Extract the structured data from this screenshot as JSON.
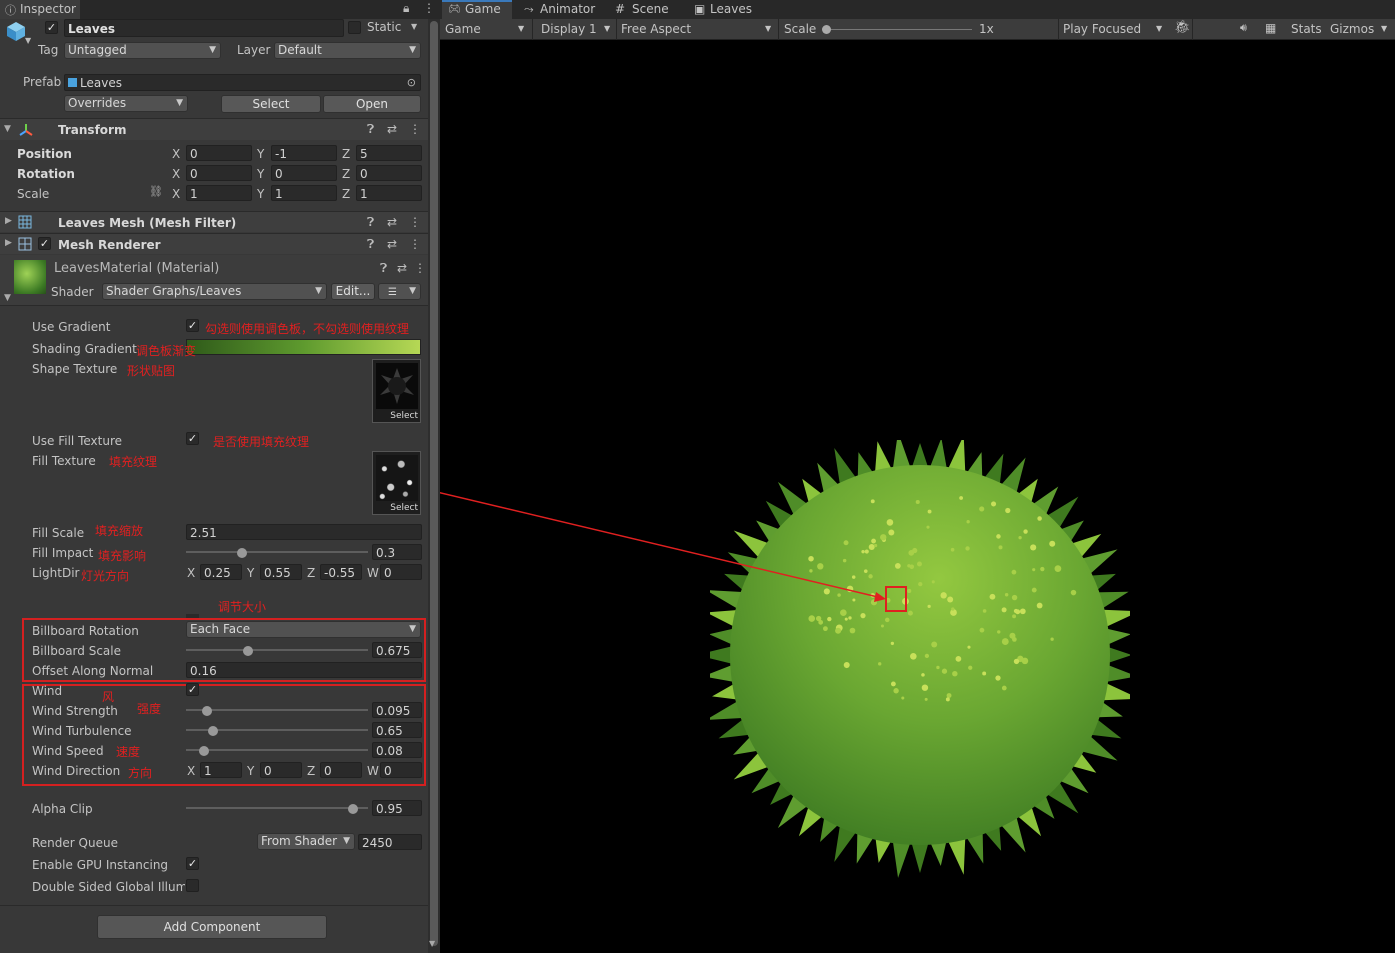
{
  "inspector": {
    "tab_label": "Inspector",
    "object_name": "Leaves",
    "static_label": "Static",
    "tag_label": "Tag",
    "tag_value": "Untagged",
    "layer_label": "Layer",
    "layer_value": "Default",
    "prefab_label": "Prefab",
    "prefab_value": "Leaves",
    "overrides_label": "Overrides",
    "select_button": "Select",
    "open_button": "Open",
    "transform": {
      "title": "Transform",
      "position_label": "Position",
      "rotation_label": "Rotation",
      "scale_label": "Scale",
      "position": {
        "x": "0",
        "y": "-1",
        "z": "5"
      },
      "rotation": {
        "x": "0",
        "y": "0",
        "z": "0"
      },
      "scale": {
        "x": "1",
        "y": "1",
        "z": "1"
      }
    },
    "mesh_filter_title": "Leaves Mesh (Mesh Filter)",
    "mesh_renderer_title": "Mesh Renderer",
    "material": {
      "title": "LeavesMaterial (Material)",
      "shader_label": "Shader",
      "shader_value": "Shader Graphs/Leaves",
      "edit_button": "Edit...",
      "use_gradient_label": "Use Gradient",
      "shading_gradient_label": "Shading Gradient",
      "shape_texture_label": "Shape Texture",
      "texture_select": "Select",
      "use_fill_texture_label": "Use Fill Texture",
      "fill_texture_label": "Fill Texture",
      "fill_scale_label": "Fill Scale",
      "fill_scale_value": "2.51",
      "fill_impact_label": "Fill Impact",
      "fill_impact_value": "0.3",
      "fill_impact_level": 0.3,
      "lightdir_label": "LightDir",
      "lightdir": {
        "x": "0.25",
        "y": "0.55",
        "z": "-0.55",
        "w": "0"
      },
      "billboard_rotation_label": "Billboard Rotation",
      "billboard_rotation_value": "Each Face",
      "billboard_scale_label": "Billboard Scale",
      "billboard_scale_value": "0.675",
      "billboard_scale_level": 0.34,
      "offset_normal_label": "Offset Along Normal",
      "offset_normal_value": "0.16",
      "wind_label": "Wind",
      "wind_strength_label": "Wind Strength",
      "wind_strength_value": "0.095",
      "wind_strength_level": 0.12,
      "wind_turbulence_label": "Wind Turbulence",
      "wind_turbulence_value": "0.65",
      "wind_turbulence_level": 0.15,
      "wind_speed_label": "Wind Speed",
      "wind_speed_value": "0.08",
      "wind_speed_level": 0.1,
      "wind_direction_label": "Wind Direction",
      "wind_direction": {
        "x": "1",
        "y": "0",
        "z": "0",
        "w": "0"
      },
      "alpha_clip_label": "Alpha Clip",
      "alpha_clip_value": "0.95",
      "alpha_clip_level": 0.92,
      "render_queue_label": "Render Queue",
      "render_queue_mode": "From Shader",
      "render_queue_value": "2450",
      "gpu_instancing_label": "Enable GPU Instancing",
      "double_sided_label": "Double Sided Global Illumin"
    },
    "add_component_button": "Add Component"
  },
  "annotations": {
    "use_gradient": "勾选则使用调色板，不勾选则使用纹理",
    "shading_gradient": "调色板渐变",
    "shape_texture": "形状贴图",
    "use_fill_texture": "是否使用填充纹理",
    "fill_texture": "填充纹理",
    "fill_scale": "填充缩放",
    "fill_impact": "填充影响",
    "lightdir": "灯光方向",
    "resize": "调节大小",
    "wind": "风",
    "strength": "强度",
    "speed": "速度",
    "direction": "方向"
  },
  "game_view": {
    "tabs": [
      "Game",
      "Animator",
      "Scene",
      "Leaves"
    ],
    "display_mode": "Game",
    "display": "Display 1",
    "aspect": "Free Aspect",
    "scale_label": "Scale",
    "scale_value": "1x",
    "play_mode": "Play Focused",
    "stats_label": "Stats",
    "gizmos_label": "Gizmos"
  },
  "colors": {
    "annotation_red": "#e02020",
    "gradient_start": "#2f5a1a",
    "gradient_end": "#b6d855",
    "bush_dark": "#3f7a1f",
    "bush_light": "#8cc43c"
  },
  "icons": [
    "cube-icon",
    "lock-icon",
    "kebab-icon",
    "transform-icon",
    "help-icon",
    "preset-icon",
    "mesh-icon",
    "link-icon",
    "bug-icon",
    "audio-icon",
    "grid-icon"
  ]
}
